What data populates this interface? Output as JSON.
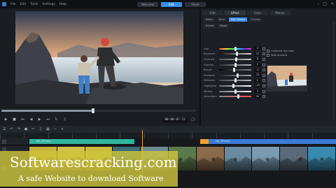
{
  "menubar": {
    "menus": [
      "File",
      "Edit",
      "Tools",
      "Settings",
      "Help"
    ],
    "mode_tabs": [
      {
        "label": "Welcome",
        "active": false
      },
      {
        "label": "Edit",
        "active": true
      },
      {
        "label": "Share",
        "active": false
      }
    ]
  },
  "player": {
    "timecode": "00:00:07:12"
  },
  "panel": {
    "tabs": [
      {
        "label": "Edit",
        "active": false
      },
      {
        "label": "Effect",
        "active": true
      },
      {
        "label": "Color",
        "active": false
      },
      {
        "label": "Motion",
        "active": false
      }
    ],
    "subtabs": [
      {
        "label": "Basic",
        "active": false
      },
      {
        "label": "Tone",
        "active": false
      },
      {
        "label": "HSL Tuning",
        "active": true
      },
      {
        "label": "Curves",
        "active": false
      }
    ],
    "preset_label": "Preset",
    "reset_label": "Reset",
    "sliders": [
      {
        "label": "Hue",
        "value": 0
      },
      {
        "label": "Exposure",
        "value": 12
      },
      {
        "label": "Contrast",
        "value": 8
      },
      {
        "label": "Gamma",
        "value": 0
      },
      {
        "label": "Blacks",
        "value": -5
      },
      {
        "label": "Shadows",
        "value": 15
      },
      {
        "label": "Midtones",
        "value": 0
      },
      {
        "label": "Highlights",
        "value": -10
      },
      {
        "label": "Whites",
        "value": 4
      },
      {
        "label": "Saturation",
        "value": 20
      }
    ],
    "options": [
      "Compare clip view",
      "Split preview"
    ]
  },
  "timeline": {
    "tracks": [
      {
        "title": "MS_TP1xxx",
        "thumbs": 2
      },
      {
        "title": "MS_TP1xxx",
        "thumbs": 9
      }
    ]
  },
  "watermark": {
    "title": "Softwarescracking.com",
    "subtitle": "A safe Website to download Software"
  },
  "colors": {
    "accent": "#3a8ee6",
    "playhead": "#f0a030",
    "watermark_bg": "#cdc33c",
    "track_green": "#2fb5a0",
    "track_blue": "#3a7bd5"
  }
}
